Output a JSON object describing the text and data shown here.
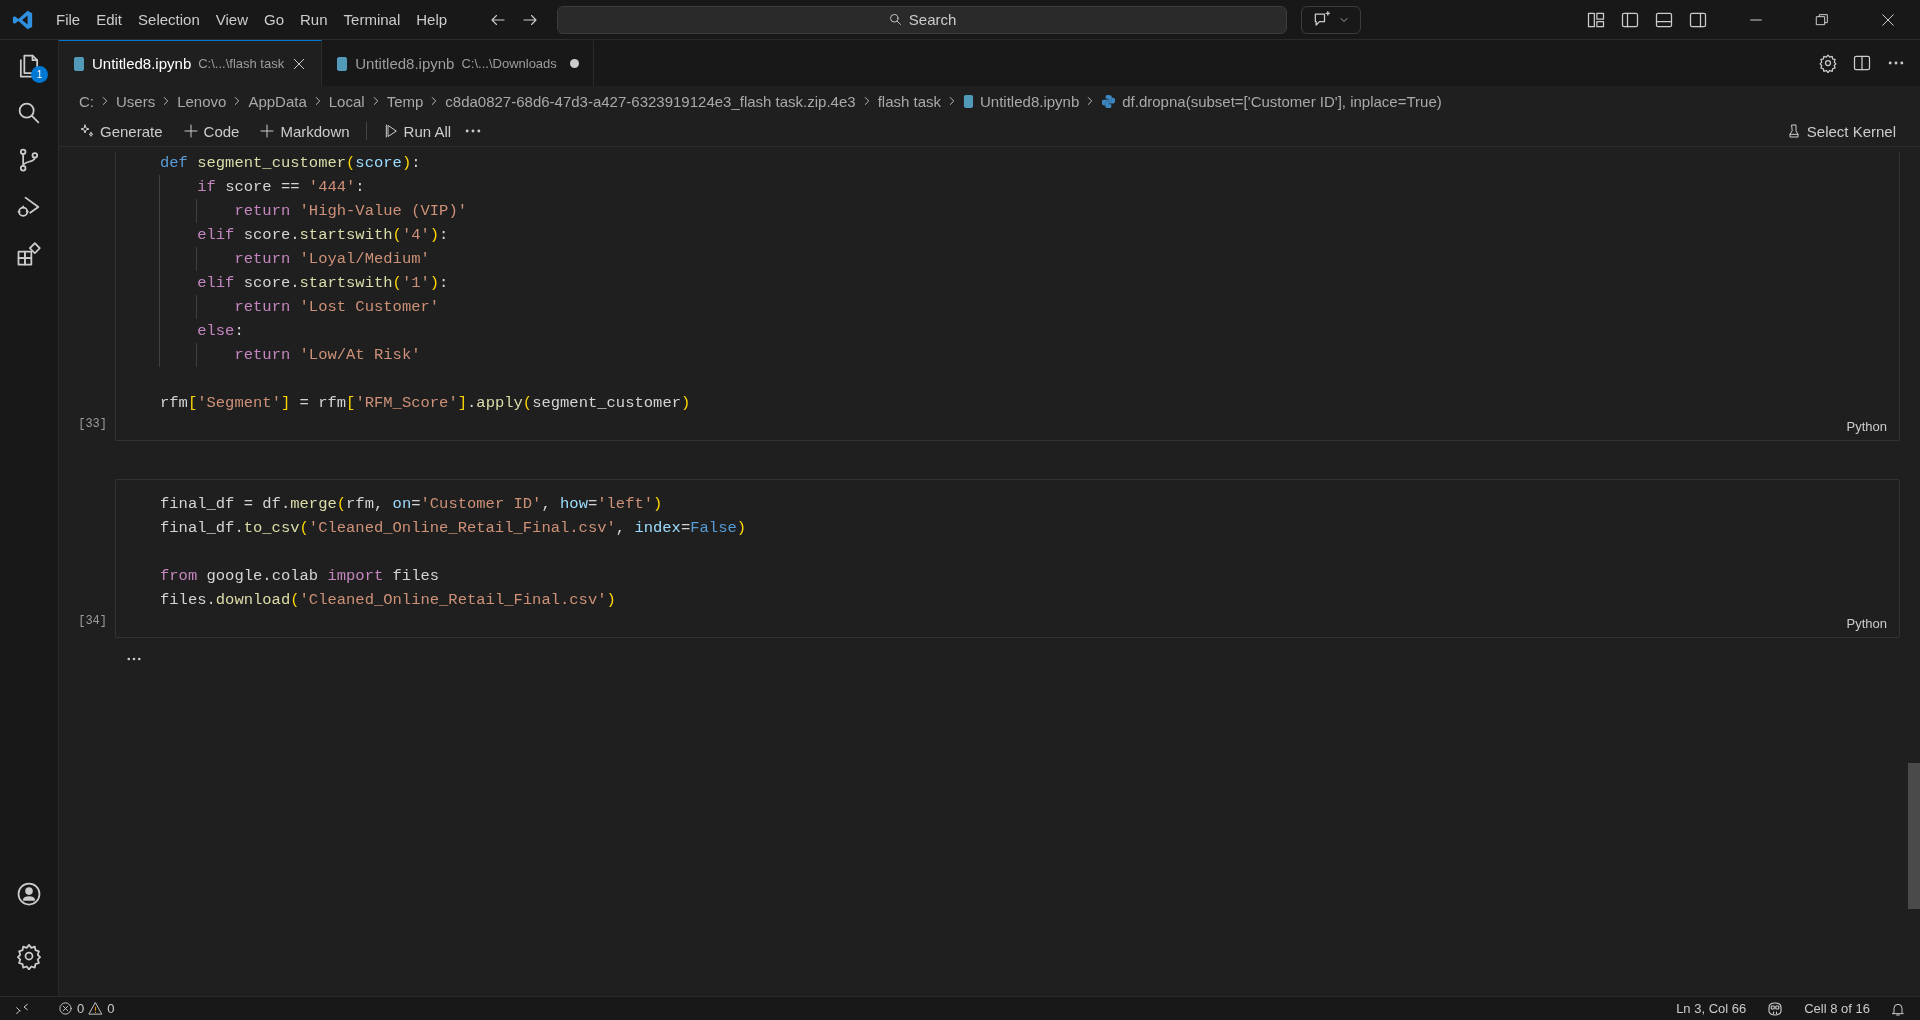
{
  "menu": [
    "File",
    "Edit",
    "Selection",
    "View",
    "Go",
    "Run",
    "Terminal",
    "Help"
  ],
  "search": {
    "placeholder": "Search"
  },
  "activity_bar": {
    "items": [
      {
        "kind": "explorer",
        "badge": "1"
      },
      {
        "kind": "search"
      },
      {
        "kind": "source-control"
      },
      {
        "kind": "run-debug"
      },
      {
        "kind": "extensions"
      }
    ],
    "bottom": [
      {
        "kind": "account"
      },
      {
        "kind": "settings"
      }
    ]
  },
  "tabs": [
    {
      "title": "Untitled8.ipynb",
      "path": "C:\\...\\flash task",
      "selected": true,
      "dirty": false
    },
    {
      "title": "Untitled8.ipynb",
      "path": "C:\\...\\Downloads",
      "selected": false,
      "dirty": true
    }
  ],
  "breadcrumbs": [
    {
      "label": "C:",
      "kind": "folder"
    },
    {
      "label": "Users",
      "kind": "folder"
    },
    {
      "label": "Lenovo",
      "kind": "folder"
    },
    {
      "label": "AppData",
      "kind": "folder"
    },
    {
      "label": "Local",
      "kind": "folder"
    },
    {
      "label": "Temp",
      "kind": "folder"
    },
    {
      "label": "c8da0827-68d6-47d3-a427-6323919124e3_flash task.zip.4e3",
      "kind": "folder"
    },
    {
      "label": "flash task",
      "kind": "folder"
    },
    {
      "label": "Untitled8.ipynb",
      "kind": "notebook"
    },
    {
      "label": "df.dropna(subset=['Customer ID'], inplace=True)",
      "kind": "symbol"
    }
  ],
  "toolbar": [
    {
      "label": "Generate",
      "kind": "sparkle"
    },
    {
      "label": "Code",
      "kind": "plus"
    },
    {
      "label": "Markdown",
      "kind": "plus"
    },
    {
      "label": "Run All",
      "kind": "run"
    }
  ],
  "kernel": {
    "label": "Select Kernel"
  },
  "cells": [
    {
      "execution_count": "[33]",
      "language": "Python",
      "lines": [
        {
          "kind": "code",
          "tokens": [
            {
              "text": "def ",
              "kind": "kw"
            },
            {
              "text": "segment_customer",
              "kind": "fn"
            },
            {
              "text": "(",
              "kind": "br"
            },
            {
              "text": "score",
              "kind": "var"
            },
            {
              "text": ")",
              "kind": "br"
            },
            {
              "text": ":",
              "kind": "txt"
            }
          ]
        },
        {
          "kind": "code",
          "tokens": [
            {
              "text": "    if",
              "kind": "ctrl"
            },
            {
              "text": " score == ",
              "kind": "txt"
            },
            {
              "text": "'444'",
              "kind": "str"
            },
            {
              "text": ":",
              "kind": "txt"
            }
          ]
        },
        {
          "kind": "code",
          "tokens": [
            {
              "text": "        return ",
              "kind": "ctrl"
            },
            {
              "text": "'High-Value (VIP)'",
              "kind": "str"
            }
          ]
        },
        {
          "kind": "code",
          "tokens": [
            {
              "text": "    elif ",
              "kind": "ctrl"
            },
            {
              "text": "score.",
              "kind": "txt"
            },
            {
              "text": "startswith",
              "kind": "fn"
            },
            {
              "text": "(",
              "kind": "br"
            },
            {
              "text": "'4'",
              "kind": "str"
            },
            {
              "text": ")",
              "kind": "br"
            },
            {
              "text": ":",
              "kind": "txt"
            }
          ]
        },
        {
          "kind": "code",
          "tokens": [
            {
              "text": "        return ",
              "kind": "ctrl"
            },
            {
              "text": "'Loyal/Medium'",
              "kind": "str"
            }
          ]
        },
        {
          "kind": "code",
          "tokens": [
            {
              "text": "    elif ",
              "kind": "ctrl"
            },
            {
              "text": "score.",
              "kind": "txt"
            },
            {
              "text": "startswith",
              "kind": "fn"
            },
            {
              "text": "(",
              "kind": "br"
            },
            {
              "text": "'1'",
              "kind": "str"
            },
            {
              "text": ")",
              "kind": "br"
            },
            {
              "text": ":",
              "kind": "txt"
            }
          ]
        },
        {
          "kind": "code",
          "tokens": [
            {
              "text": "        return ",
              "kind": "ctrl"
            },
            {
              "text": "'Lost Customer'",
              "kind": "str"
            }
          ]
        },
        {
          "kind": "code",
          "tokens": [
            {
              "text": "    else",
              "kind": "ctrl"
            },
            {
              "text": ":",
              "kind": "txt"
            }
          ]
        },
        {
          "kind": "code",
          "tokens": [
            {
              "text": "        return ",
              "kind": "ctrl"
            },
            {
              "text": "'Low/At Risk'",
              "kind": "str"
            }
          ]
        },
        {
          "kind": "blank"
        },
        {
          "kind": "code",
          "tokens": [
            {
              "text": "rfm",
              "kind": "txt"
            },
            {
              "text": "[",
              "kind": "br"
            },
            {
              "text": "'Segment'",
              "kind": "str"
            },
            {
              "text": "]",
              "kind": "br"
            },
            {
              "text": " = rfm",
              "kind": "txt"
            },
            {
              "text": "[",
              "kind": "br"
            },
            {
              "text": "'RFM_Score'",
              "kind": "str"
            },
            {
              "text": "]",
              "kind": "br"
            },
            {
              "text": ".",
              "kind": "txt"
            },
            {
              "text": "apply",
              "kind": "fn"
            },
            {
              "text": "(",
              "kind": "br"
            },
            {
              "text": "segment_customer",
              "kind": "txt"
            },
            {
              "text": ")",
              "kind": "br"
            }
          ]
        }
      ]
    },
    {
      "execution_count": "[34]",
      "language": "Python",
      "lines": [
        {
          "kind": "code",
          "tokens": [
            {
              "text": "final_df = df.",
              "kind": "txt"
            },
            {
              "text": "merge",
              "kind": "fn"
            },
            {
              "text": "(",
              "kind": "br"
            },
            {
              "text": "rfm, ",
              "kind": "txt"
            },
            {
              "text": "on",
              "kind": "var"
            },
            {
              "text": "=",
              "kind": "txt"
            },
            {
              "text": "'Customer ID'",
              "kind": "str"
            },
            {
              "text": ", ",
              "kind": "txt"
            },
            {
              "text": "how",
              "kind": "var"
            },
            {
              "text": "=",
              "kind": "txt"
            },
            {
              "text": "'left'",
              "kind": "str"
            },
            {
              "text": ")",
              "kind": "br"
            }
          ]
        },
        {
          "kind": "code",
          "tokens": [
            {
              "text": "final_df.",
              "kind": "txt"
            },
            {
              "text": "to_csv",
              "kind": "fn"
            },
            {
              "text": "(",
              "kind": "br"
            },
            {
              "text": "'Cleaned_Online_Retail_Final.csv'",
              "kind": "str"
            },
            {
              "text": ", ",
              "kind": "txt"
            },
            {
              "text": "index",
              "kind": "var"
            },
            {
              "text": "=",
              "kind": "txt"
            },
            {
              "text": "False",
              "kind": "kw"
            },
            {
              "text": ")",
              "kind": "br"
            }
          ]
        },
        {
          "kind": "blank"
        },
        {
          "kind": "code",
          "tokens": [
            {
              "text": "from",
              "kind": "ctrl"
            },
            {
              "text": " google.colab ",
              "kind": "txt"
            },
            {
              "text": "import",
              "kind": "ctrl"
            },
            {
              "text": " files",
              "kind": "txt"
            }
          ]
        },
        {
          "kind": "code",
          "tokens": [
            {
              "text": "files.",
              "kind": "txt"
            },
            {
              "text": "download",
              "kind": "fn"
            },
            {
              "text": "(",
              "kind": "br"
            },
            {
              "text": "'Cleaned_Online_Retail_Final.csv'",
              "kind": "str"
            },
            {
              "text": ")",
              "kind": "br"
            }
          ]
        }
      ]
    }
  ],
  "status_bar": {
    "errors": "0",
    "warnings": "0",
    "position": "Ln 3, Col 66",
    "cell": "Cell 8 of 16"
  }
}
